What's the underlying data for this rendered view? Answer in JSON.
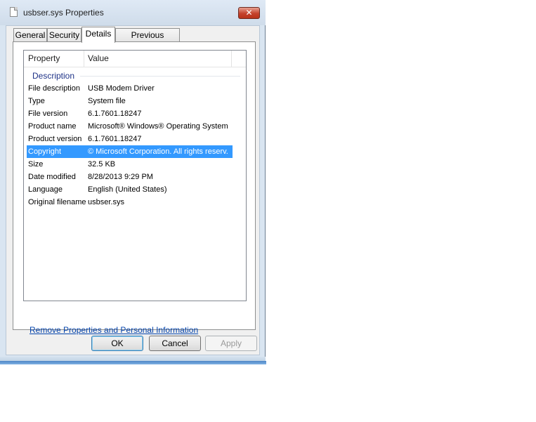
{
  "window": {
    "title": "usbser.sys Properties",
    "close_glyph": "✕"
  },
  "tabs": [
    {
      "label": "General"
    },
    {
      "label": "Security"
    },
    {
      "label": "Details"
    },
    {
      "label": "Previous Versions"
    }
  ],
  "listview": {
    "columns": [
      "Property",
      "Value"
    ],
    "group": "Description",
    "rows": [
      {
        "property": "File description",
        "value": "USB Modem Driver"
      },
      {
        "property": "Type",
        "value": "System file"
      },
      {
        "property": "File version",
        "value": "6.1.7601.18247"
      },
      {
        "property": "Product name",
        "value": "Microsoft® Windows® Operating System"
      },
      {
        "property": "Product version",
        "value": "6.1.7601.18247"
      },
      {
        "property": "Copyright",
        "value": "© Microsoft Corporation. All rights reserv..."
      },
      {
        "property": "Size",
        "value": "32.5 KB"
      },
      {
        "property": "Date modified",
        "value": "8/28/2013 9:29 PM"
      },
      {
        "property": "Language",
        "value": "English (United States)"
      },
      {
        "property": "Original filename",
        "value": "usbser.sys"
      }
    ],
    "selected_index": 5
  },
  "link": "Remove Properties and Personal Information",
  "buttons": {
    "ok": "OK",
    "cancel": "Cancel",
    "apply": "Apply"
  },
  "colors": {
    "selection": "#3399ff",
    "link": "#0645ad",
    "group_header": "#1e3287"
  }
}
